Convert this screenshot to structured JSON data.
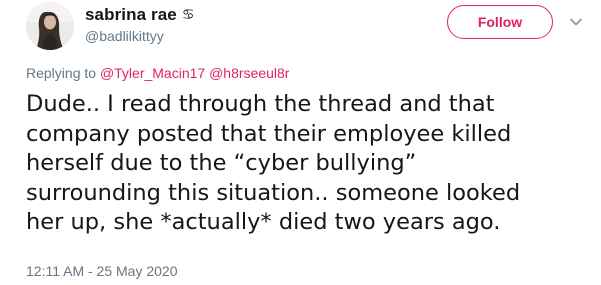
{
  "author": {
    "display_name": "sabrina rae",
    "name_emoji": "♋",
    "handle": "@badlilkittyy"
  },
  "actions": {
    "follow_label": "Follow",
    "menu_icon": "chevron-down-icon"
  },
  "reply_context": {
    "prefix": "Replying to",
    "mentions": [
      "@Tyler_Macin17",
      "@h8rseeul8r"
    ]
  },
  "tweet": {
    "lines": [
      "Dude.. I read through the thread and that",
      "company posted that their employee killed",
      "herself due to the “cyber bullying”",
      "surrounding this situation.. someone looked",
      "her up, she *actually* died two years ago."
    ],
    "timestamp": "12:11 AM - 25 May 2020"
  },
  "colors": {
    "accent": "#e0245e",
    "text": "#14171a",
    "muted": "#657786"
  }
}
